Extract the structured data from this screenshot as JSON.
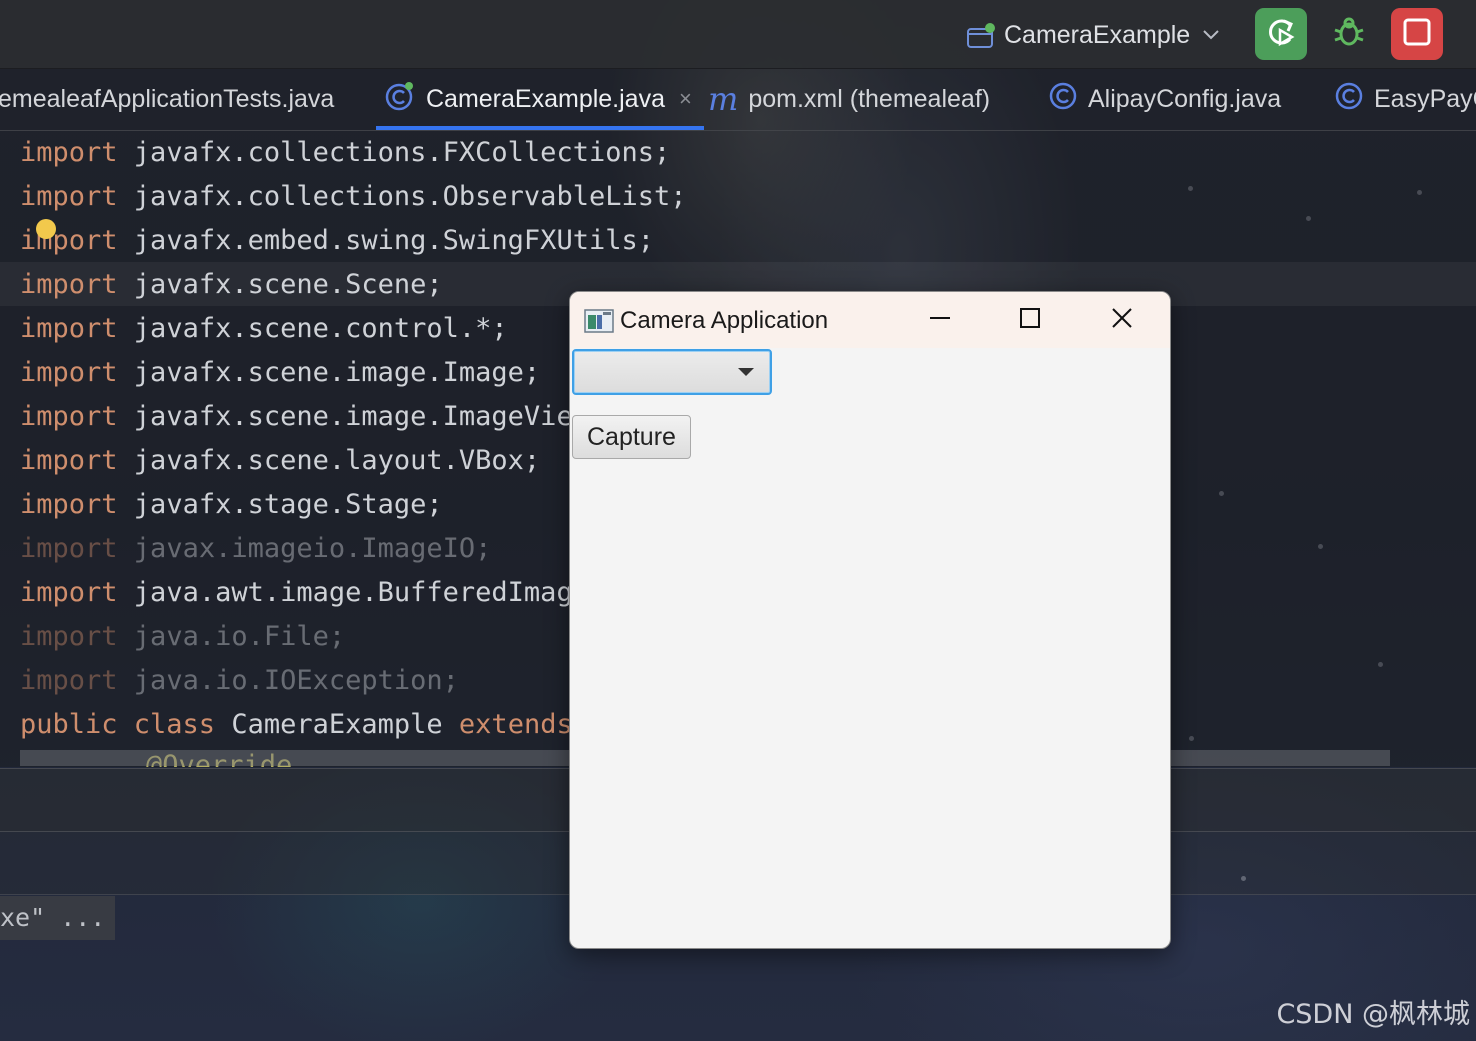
{
  "toolbar": {
    "run_config_name": "CameraExample",
    "icons": [
      "run-config-icon",
      "chevron-down-icon",
      "rerun-icon",
      "debug-icon",
      "stop-icon"
    ],
    "accent_green": "#4c9e5a",
    "accent_red": "#d64545"
  },
  "tabs": [
    {
      "label": "emealeafApplicationTests.java",
      "icon": "none",
      "active": false
    },
    {
      "label": "CameraExample.java",
      "icon": "java-class-icon",
      "active": true,
      "close": "×"
    },
    {
      "label": "pom.xml (themealeaf)",
      "icon": "maven-icon",
      "icon_glyph": "m",
      "active": false
    },
    {
      "label": "AlipayConfig.java",
      "icon": "java-class-icon",
      "active": false
    },
    {
      "label": "EasyPayC",
      "icon": "java-class-icon",
      "active": false
    }
  ],
  "code": {
    "keyword_color": "#cf8e6d",
    "lines": [
      {
        "kw": "import",
        "text": " javafx.collections.FXCollections;",
        "dim": false
      },
      {
        "kw": "import",
        "text": " javafx.collections.ObservableList;",
        "dim": false
      },
      {
        "kw": "import",
        "text": " javafx.embed.swing.SwingFXUtils;",
        "dim": false
      },
      {
        "kw": "import",
        "text": " javafx.scene.Scene;",
        "dim": false
      },
      {
        "kw": "import",
        "text": " javafx.scene.control.*;",
        "dim": false
      },
      {
        "kw": "import",
        "text": " javafx.scene.image.Image;",
        "dim": false
      },
      {
        "kw": "import",
        "text": " javafx.scene.image.ImageView",
        "dim": false
      },
      {
        "kw": "import",
        "text": " javafx.scene.layout.VBox;",
        "dim": false
      },
      {
        "kw": "import",
        "text": " javafx.stage.Stage;",
        "dim": false
      },
      {
        "kw": "import",
        "text": " javax.imageio.ImageIO;",
        "dim": true
      },
      {
        "kw": "import",
        "text": " java.awt.image.BufferedImage",
        "dim": false
      },
      {
        "kw": "import",
        "text": " java.io.File;",
        "dim": true
      },
      {
        "kw": "import",
        "text": " java.io.IOException;",
        "dim": true
      },
      {
        "kw": "public class",
        "text": " CameraExample ",
        "kw2": "extends",
        "dim": false
      }
    ],
    "annotation_fragment": "@Override"
  },
  "console": {
    "fragment": "xe\" ..."
  },
  "watermark": "CSDN @枫林城",
  "fx_window": {
    "title": "Camera Application",
    "combo_value": "",
    "capture_label": "Capture",
    "controls": [
      "minimize-icon",
      "maximize-icon",
      "close-icon"
    ]
  }
}
